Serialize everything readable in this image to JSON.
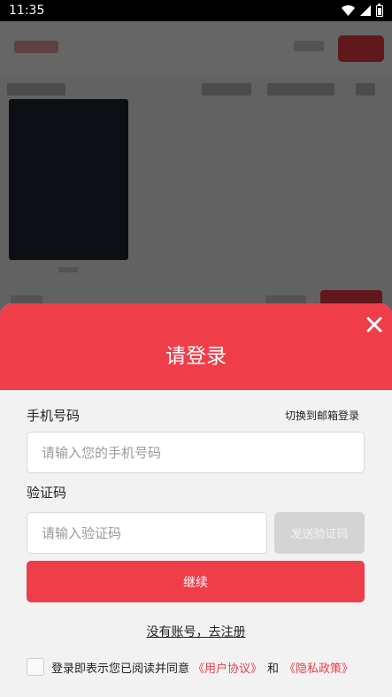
{
  "status_bar": {
    "time": "11:35",
    "icons": [
      "wifi-icon",
      "signal-icon",
      "battery-icon"
    ]
  },
  "login_sheet": {
    "title": "请登录",
    "close_icon": "close-icon",
    "phone_label": "手机号码",
    "switch_to_email": "切换到邮箱登录",
    "phone_placeholder": "请输入您的手机号码",
    "phone_value": "",
    "code_label": "验证码",
    "code_placeholder": "请输入验证码",
    "code_value": "",
    "send_code_button": "发送验证码",
    "continue_button": "继续",
    "register_link": "没有账号，去注册",
    "agreement": {
      "checked": false,
      "prefix": "登录即表示您已阅读并同意",
      "user_agreement": "《用户协议》",
      "and": "和",
      "privacy_policy": "《隐私政策》"
    }
  },
  "colors": {
    "accent": "#ef3d4a",
    "sheet_background": "#f2f2f2",
    "disabled_button": "#d4d4d4"
  }
}
